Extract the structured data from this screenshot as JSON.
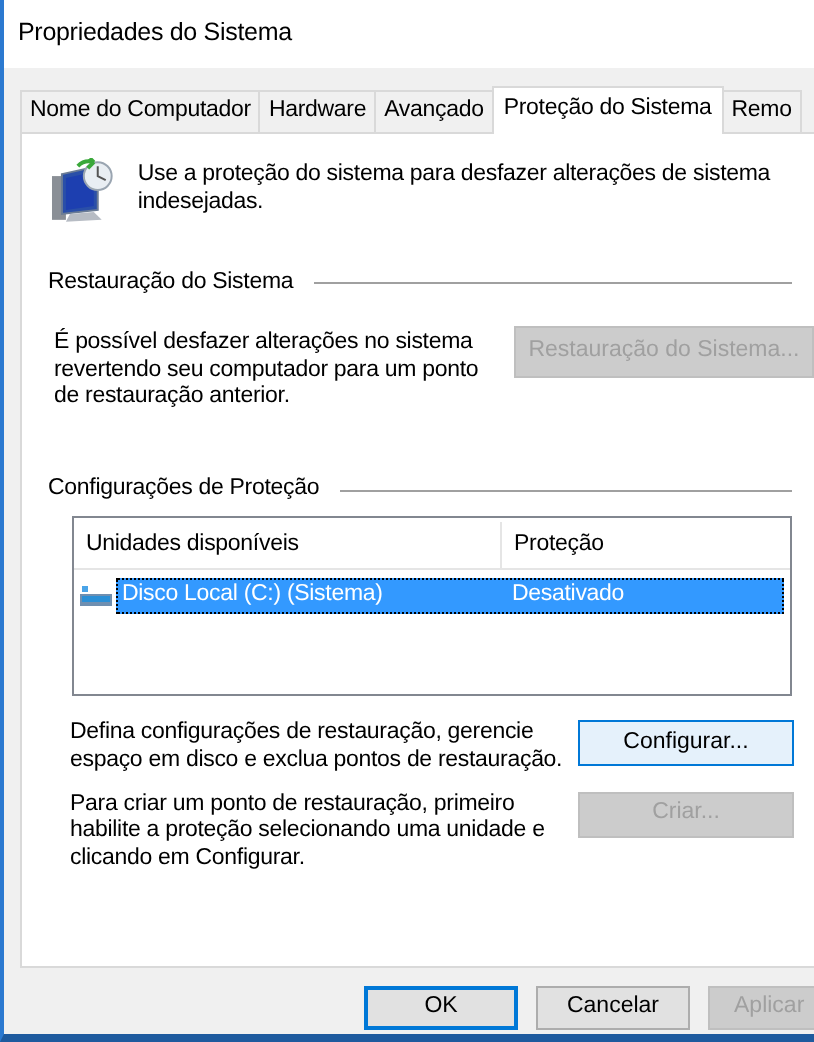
{
  "window": {
    "title": "Propriedades do Sistema"
  },
  "tabs": [
    {
      "label": "Nome do Computador",
      "selected": false
    },
    {
      "label": "Hardware",
      "selected": false
    },
    {
      "label": "Avançado",
      "selected": false
    },
    {
      "label": "Proteção do Sistema",
      "selected": true
    },
    {
      "label": "Remo",
      "selected": false
    }
  ],
  "intro": {
    "text": "Use a proteção do sistema para desfazer alterações de sistema indesejadas."
  },
  "restore_section": {
    "heading": "Restauração do Sistema",
    "text": "É possível desfazer alterações no sistema revertendo seu computador para um ponto de restauração anterior.",
    "button": {
      "label": "Restauração do Sistema...",
      "disabled": true,
      "highlighted": false
    }
  },
  "protection_section": {
    "heading": "Configurações de Proteção",
    "table": {
      "columns": [
        "Unidades disponíveis",
        "Proteção"
      ],
      "rows": [
        {
          "cells": [
            "Disco Local (C:) (Sistema)",
            "Desativado"
          ],
          "selected": true
        }
      ]
    },
    "actions": [
      {
        "text": "Defina configurações de restauração, gerencie espaço em disco e exclua pontos de restauração.",
        "button": {
          "label": "Configurar...",
          "disabled": false,
          "highlighted": true
        }
      },
      {
        "text": "Para criar um ponto de restauração, primeiro habilite a proteção selecionando uma unidade e clicando em Configurar.",
        "button": {
          "label": "Criar...",
          "disabled": true,
          "highlighted": false
        }
      }
    ]
  },
  "buttons": [
    {
      "label": "OK",
      "default": true,
      "disabled": false
    },
    {
      "label": "Cancelar",
      "default": false,
      "disabled": false
    },
    {
      "label": "Aplicar",
      "default": false,
      "disabled": true
    }
  ]
}
